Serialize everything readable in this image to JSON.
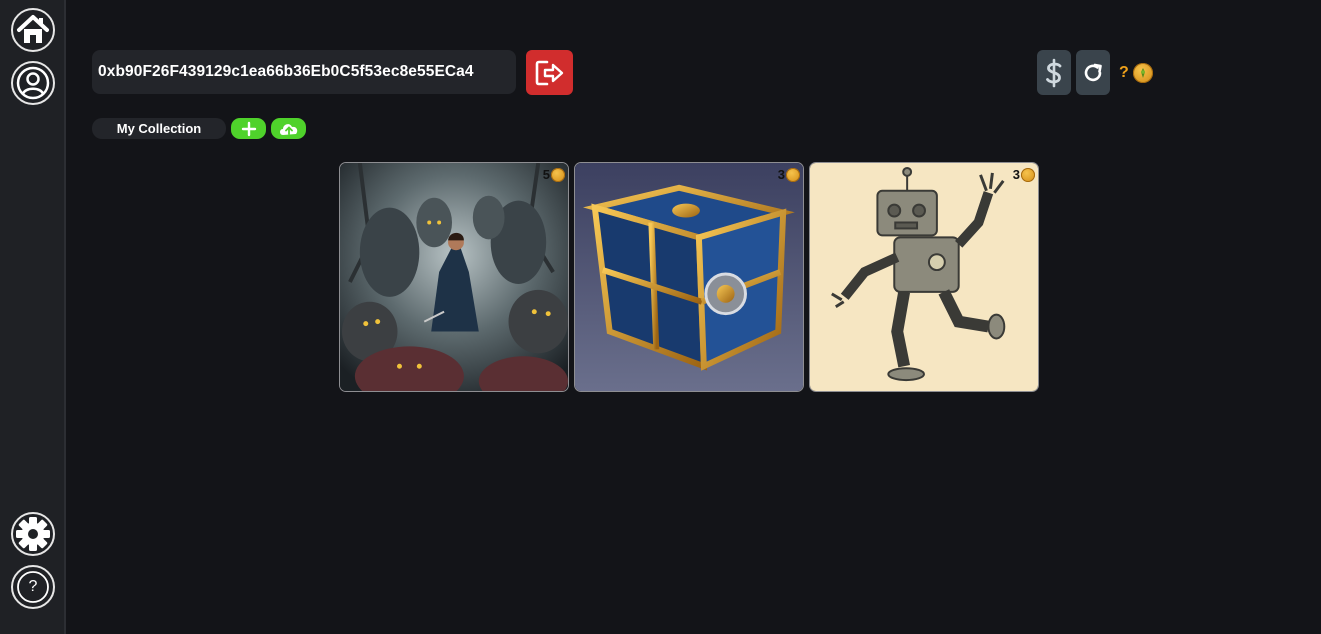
{
  "sidebar": {
    "items": [
      {
        "name": "home",
        "icon": "home-icon"
      },
      {
        "name": "profile",
        "icon": "user-circle-icon"
      },
      {
        "name": "settings",
        "icon": "gear-icon"
      },
      {
        "name": "help",
        "icon": "question-icon",
        "glyph": "?"
      }
    ]
  },
  "header": {
    "wallet_address": "0xb90F26F439129c1ea66b36Eb0C5f53ec8e55ECa4",
    "logout_icon": "logout-icon",
    "buy_icon": "dollar-icon",
    "refresh_icon": "refresh-icon",
    "balance": "?",
    "currency_icon": "coin-icon"
  },
  "collection": {
    "label": "My Collection",
    "add_icon": "plus-icon",
    "upload_icon": "cloud-upload-icon"
  },
  "gallery": {
    "cards": [
      {
        "subject": "dark fantasy warrior surrounded by ghouls",
        "price": "5"
      },
      {
        "subject": "ornate golden-framed blue cube",
        "price": "3"
      },
      {
        "subject": "sketched dancing robot",
        "price": "3"
      }
    ]
  },
  "colors": {
    "background": "#131418",
    "sidebar": "#1f2125",
    "logout": "#d12d2d",
    "accent_green": "#4fd22b",
    "coin": "#f0a21b"
  }
}
